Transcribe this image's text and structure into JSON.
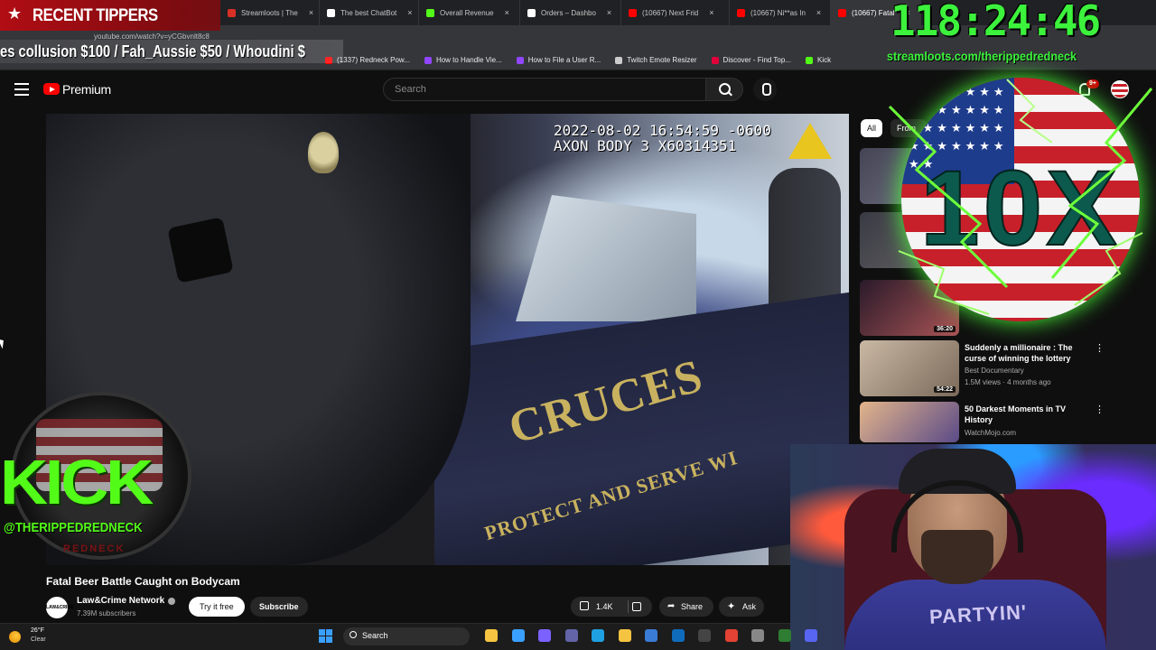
{
  "browser": {
    "tabs": [
      {
        "label": "Streamloots | The",
        "color": "#d93025"
      },
      {
        "label": "The best ChatBot",
        "color": "#ffffff"
      },
      {
        "label": "Overall Revenue",
        "color": "#53fc18"
      },
      {
        "label": "Orders – Dashbo",
        "color": "#ffffff"
      },
      {
        "label": "(10667) Next Frid",
        "color": "#ff0000"
      },
      {
        "label": "(10667) Ni**as In",
        "color": "#ff0000"
      },
      {
        "label": "(10667) Fatal",
        "color": "#ff0000"
      }
    ],
    "url": "youtube.com/watch?v=yCGbvnlt8c8",
    "bookmarks": [
      {
        "label": "(1337) Redneck Pow...",
        "color": "#ff0000"
      },
      {
        "label": "How to Handle Vie...",
        "color": "#9146ff"
      },
      {
        "label": "How to File a User R...",
        "color": "#9146ff"
      },
      {
        "label": "Twitch Emote Resizer",
        "color": "#cccccc"
      },
      {
        "label": "Discover - Find Top...",
        "color": "#e2003b"
      },
      {
        "label": "Kick",
        "color": "#53fc18"
      }
    ]
  },
  "youtube": {
    "brand": "Premium",
    "search_placeholder": "Search",
    "notification_count": "9+",
    "chips": {
      "all": "All",
      "from": "From"
    },
    "video": {
      "timestamp": "2022-08-02 16:54:59 -0600\nAXON BODY 3 X60314351",
      "car_text_big": "CRUCES",
      "car_text_small": "PROTECT AND SERVE WI",
      "title": "Fatal Beer Battle Caught on Bodycam",
      "channel_logo": "LAW&CRIME",
      "channel": "Law&Crime Network",
      "subscribers": "7.39M subscribers",
      "try_free": "Try it free",
      "subscribe": "Subscribe",
      "likes": "1.4K",
      "share": "Share",
      "ask": "Ask"
    },
    "recommendations": [
      {
        "duration": "36:20",
        "title": "",
        "channel": "",
        "meta": ""
      },
      {
        "duration": "54:22",
        "title": "Suddenly a millionaire : The curse of winning the lottery",
        "channel": "Best Documentary",
        "meta": "1.5M views · 4 months ago"
      },
      {
        "duration": "",
        "title": "50 Darkest Moments in TV History",
        "channel": "WatchMojo.com",
        "meta": ""
      }
    ]
  },
  "overlay": {
    "recent_tippers_label": "RECENT TIPPERS",
    "ticker": "es collusion $100 / Fah_Aussie $50 / Whoudini $",
    "timer": "118:24:46",
    "streamloots_url": "streamloots.com/therippedredneck",
    "badge_text": "10X",
    "kick_label": "KICK",
    "kick_handle": "@THERIPPEDREDNECK",
    "kick_sub": "REDNECK",
    "shirt_text": "PARTYIN'"
  },
  "taskbar": {
    "temp": "26°F",
    "condition": "Clear",
    "search": "Search",
    "apps": [
      {
        "name": "file-explorer",
        "color": "#f5c542"
      },
      {
        "name": "store",
        "color": "#3aa0ff"
      },
      {
        "name": "copilot",
        "color": "#7b61ff"
      },
      {
        "name": "teams",
        "color": "#6264a7"
      },
      {
        "name": "edge",
        "color": "#1fa0e3"
      },
      {
        "name": "folder",
        "color": "#f5c542"
      },
      {
        "name": "calendar",
        "color": "#3a7bd5"
      },
      {
        "name": "outlook",
        "color": "#0f6cbd"
      },
      {
        "name": "obs",
        "color": "#444444"
      },
      {
        "name": "chrome",
        "color": "#e34234"
      },
      {
        "name": "network",
        "color": "#888888"
      },
      {
        "name": "stocks",
        "color": "#2e7d32"
      },
      {
        "name": "discord",
        "color": "#5865f2"
      }
    ]
  },
  "colors": {
    "accent_green": "#3cf23c",
    "kick_green": "#53fc18",
    "yt_red": "#ff0000"
  }
}
